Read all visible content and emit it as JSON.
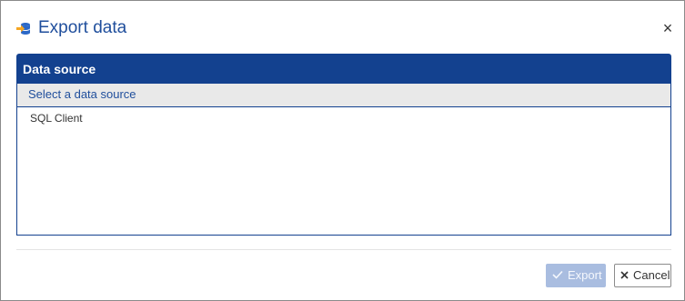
{
  "dialog": {
    "title": "Export data",
    "title_icon": "database-export-icon",
    "close_icon": "close-icon",
    "close_glyph": "×"
  },
  "data_source": {
    "header": "Data source",
    "list_title": "Select a data source",
    "items": [
      {
        "label": "SQL Client"
      }
    ]
  },
  "footer": {
    "export_label": "Export",
    "export_icon": "checkmark-icon",
    "export_disabled": true,
    "cancel_label": "Cancel",
    "cancel_icon": "x-icon"
  },
  "colors": {
    "primary": "#13418f",
    "title_text": "#1f4e9c",
    "list_header_bg": "#e9e9e9",
    "export_disabled_bg": "#a9bde0",
    "icon_orange": "#f5a623"
  }
}
